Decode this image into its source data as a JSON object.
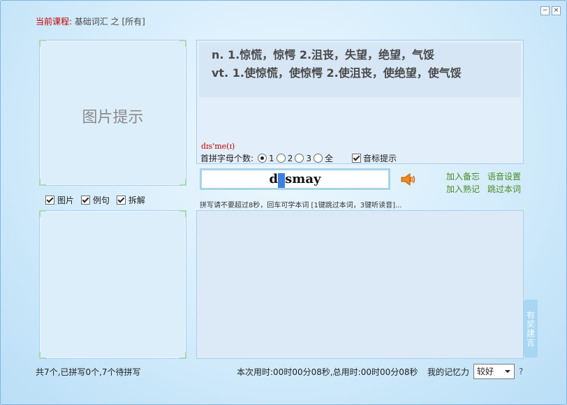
{
  "window": {
    "minimize": "−",
    "close": "×"
  },
  "course": {
    "label": "当前课程:",
    "value": " 基础词汇 之 [所有]"
  },
  "image_hint": "图片提示",
  "options": [
    {
      "label": "图片",
      "checked": true
    },
    {
      "label": "例句",
      "checked": true
    },
    {
      "label": "拆解",
      "checked": true
    }
  ],
  "definition": {
    "line1": "n.  1.惊慌，惊愕  2.沮丧，失望，绝望，气馁",
    "line2": "vt.  1.使惊慌，使惊愕  2.使沮丧，使绝望，使气馁"
  },
  "phonetic": "dɪs'me(ɪ)",
  "first_letters": {
    "label": "首拼字母个数:",
    "choices": [
      "1",
      "2",
      "3",
      "全"
    ],
    "selected": "1"
  },
  "phonetic_hint": {
    "label": "音标提示",
    "checked": true
  },
  "spelling": {
    "before": "d",
    "cursor": "i",
    "after": "smay"
  },
  "links": {
    "add_memo": "加入备忘",
    "voice_settings": "语音设置",
    "add_familiar": "加入熟记",
    "skip_word": "跳过本词"
  },
  "hint": "拼写请不要超过8秒，回车可学本词 [1键跳过本词，3键听读音]...",
  "suggest": "有奖建言",
  "status": {
    "progress": "共7个,已拼写0个,7个待拼写",
    "time": "本次用时:00时00分08秒,总用时:00时00分08秒",
    "memory_label": "我的记忆力",
    "memory_value": "较好",
    "help": "?"
  }
}
